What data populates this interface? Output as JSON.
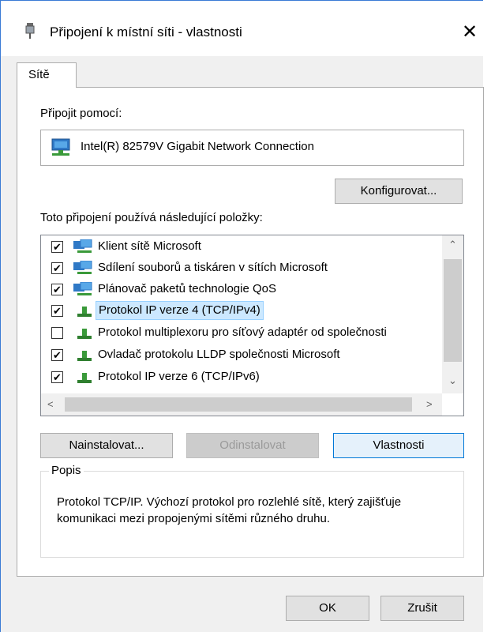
{
  "window": {
    "title": "Připojení k místní síti - vlastnosti",
    "close_glyph": "✕"
  },
  "tabs": [
    {
      "label": "Sítě"
    }
  ],
  "connect_label": "Připojit pomocí:",
  "adapter_name": "Intel(R) 82579V Gigabit Network Connection",
  "configure_label": "Konfigurovat...",
  "items_label": "Toto připojení používá následující položky:",
  "items": [
    {
      "label": "Klient sítě Microsoft",
      "checked": true,
      "icon": "network-client-icon"
    },
    {
      "label": "Sdílení souborů a tiskáren v sítích Microsoft",
      "checked": true,
      "icon": "file-sharing-icon"
    },
    {
      "label": "Plánovač paketů technologie QoS",
      "checked": true,
      "icon": "qos-icon"
    },
    {
      "label": "Protokol IP verze 4 (TCP/IPv4)",
      "checked": true,
      "selected": true,
      "icon": "protocol-icon"
    },
    {
      "label": "Protokol multiplexoru pro síťový adaptér od společnosti",
      "checked": false,
      "icon": "protocol-icon"
    },
    {
      "label": "Ovladač protokolu LLDP společnosti Microsoft",
      "checked": true,
      "icon": "protocol-icon"
    },
    {
      "label": "Protokol IP verze 6 (TCP/IPv6)",
      "checked": true,
      "icon": "protocol-icon"
    }
  ],
  "buttons": {
    "install": "Nainstalovat...",
    "uninstall": "Odinstalovat",
    "properties": "Vlastnosti",
    "ok": "OK",
    "cancel": "Zrušit"
  },
  "description": {
    "legend": "Popis",
    "text": "Protokol TCP/IP. Výchozí protokol pro rozlehlé sítě, který zajišťuje komunikaci mezi propojenými sítěmi různého druhu."
  },
  "check_glyph": "✔",
  "colors": {
    "accent": "#0078d7",
    "selection": "#cce8ff",
    "window_border": "#3a7bd5"
  }
}
